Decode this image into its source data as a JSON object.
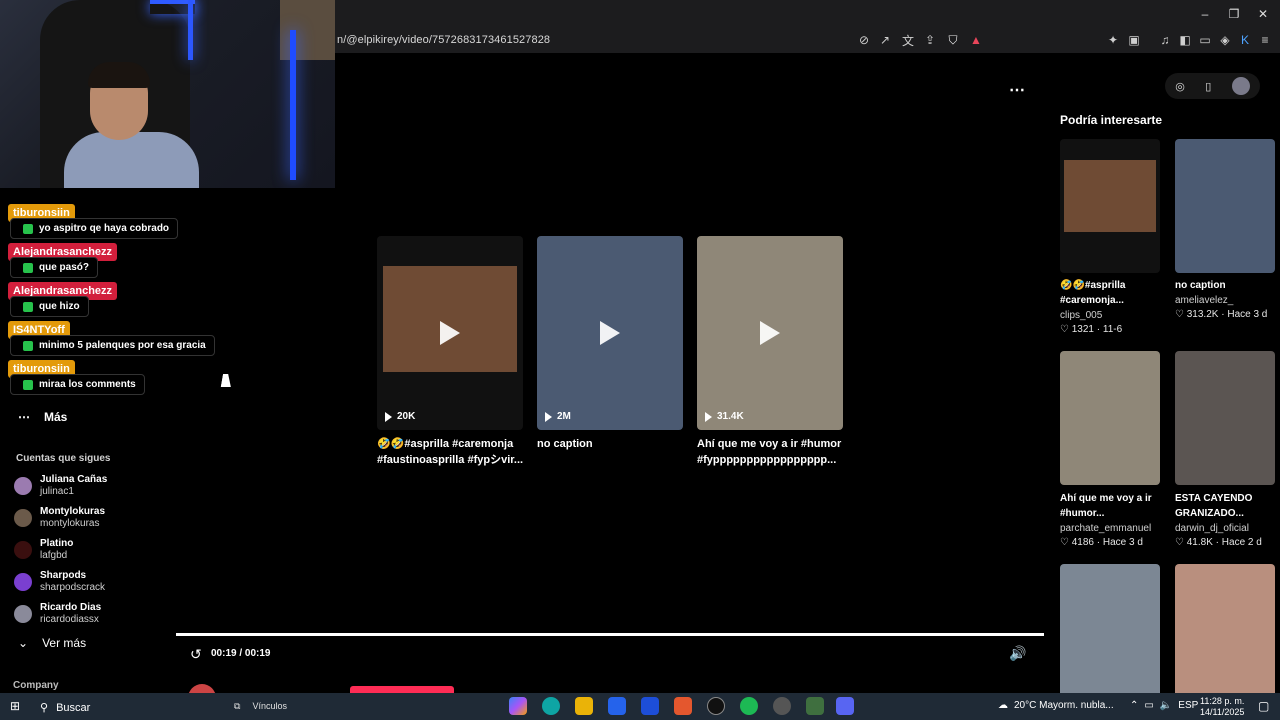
{
  "browser": {
    "url": "n/@elpikirey/video/7572683173461527828",
    "window_controls": [
      "–",
      "❐",
      "✕"
    ]
  },
  "chat": [
    {
      "user": "tiburonsiin",
      "color": "#e39a0a",
      "message": "yo aspitro qe haya cobrado"
    },
    {
      "user": "Alejandrasanchezz",
      "color": "#d21f3c",
      "message": "que pasó?"
    },
    {
      "user": "Alejandrasanchezz",
      "color": "#d21f3c",
      "message": "que hizo"
    },
    {
      "user": "IS4NTYoff",
      "color": "#e39a0a",
      "message": "minimo 5 palenques por esa gracia"
    },
    {
      "user": "tiburonsiin",
      "color": "#e39a0a",
      "message": "miraa los comments"
    }
  ],
  "sidebar": {
    "more_label": "Más",
    "following_title": "Cuentas que sigues",
    "following": [
      {
        "name": "Juliana Cañas",
        "username": "julinac1",
        "color": "#9b7bb0"
      },
      {
        "name": "Montylokuras",
        "username": "montylokuras",
        "color": "#6b5a4a"
      },
      {
        "name": "Platino",
        "username": "lafgbd",
        "color": "#3a0f0f"
      },
      {
        "name": "Sharpods",
        "username": "sharpodscrack",
        "color": "#7a3fd0"
      },
      {
        "name": "Ricardo Dias",
        "username": "ricardodiassx",
        "color": "#8a8a9a"
      }
    ],
    "see_more_label": "Ver más",
    "company_label": "Company"
  },
  "main": {
    "more_icon": "⋯",
    "videos": [
      {
        "views": "20K",
        "caption": "🤣🤣#asprilla #caremonja #faustinoasprilla #fypシvir...",
        "bg": "#6f4b34"
      },
      {
        "views": "2M",
        "caption": "no caption",
        "bg": "#4b5a72"
      },
      {
        "views": "31.4K",
        "caption": "Ahí que me voy a ir #humor #fyppppppppppppppppp...",
        "bg": "#8f8778"
      }
    ],
    "player": {
      "time": "00:19 / 00:19",
      "progress": 1.0
    },
    "author": "elpikirey"
  },
  "right": {
    "title": "Podría interesarte",
    "items": [
      {
        "caption": "🤣🤣#asprilla #caremonja...",
        "author": "clips_005",
        "likes": "1321",
        "date": "11-6",
        "bg": "#6f4b34"
      },
      {
        "caption": "no caption",
        "author": "ameliavelez_",
        "likes": "313.2K",
        "date": "Hace 3 d",
        "bg": "#4b5a72"
      },
      {
        "caption": "Ahí que me voy a ir #humor...",
        "author": "parchate_emmanuel",
        "likes": "4186",
        "date": "Hace 3 d",
        "bg": "#8f8778"
      },
      {
        "caption": "ESTA CAYENDO GRANIZADO...",
        "author": "darwin_dj_oficial",
        "likes": "41.8K",
        "date": "Hace 2 d",
        "bg": "#5b5552"
      },
      {
        "caption": "",
        "author": "",
        "likes": "",
        "date": "",
        "bg": "#7c8794"
      },
      {
        "caption": "",
        "author": "",
        "likes": "",
        "date": "",
        "bg": "#b98f7e"
      }
    ]
  },
  "taskbar": {
    "search_label": "Buscar",
    "links_label": "Vínculos",
    "weather": "20°C Mayorm. nubla...",
    "lang": "ESP",
    "time": "11:28 p. m.",
    "date": "14/11/2025"
  }
}
